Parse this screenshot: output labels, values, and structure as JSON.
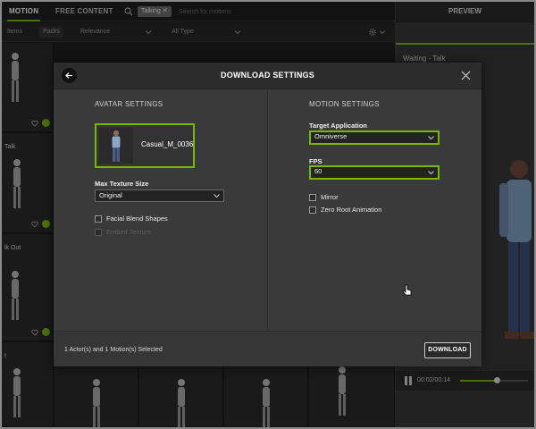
{
  "topbar": {
    "tabs": [
      {
        "label": "MOTION",
        "active": true
      },
      {
        "label": "FREE CONTENT",
        "active": false
      }
    ],
    "search": {
      "icon": "search-icon",
      "chip": "Talking",
      "chip_remove": "✕",
      "placeholder": "Search for motions"
    },
    "preview_header": "PREVIEW"
  },
  "filterbar": {
    "items_label": "Items",
    "packs_label": "Packs",
    "sort_label": "Relevance",
    "type_label": "All Type"
  },
  "grid": {
    "labels": [
      "Talk",
      "lk Out",
      "t"
    ]
  },
  "preview": {
    "title": "Waiting - Talk",
    "time": "00:02/00:14",
    "progress": 0.55
  },
  "modal": {
    "title": "DOWNLOAD SETTINGS",
    "avatar_settings": {
      "title": "AVATAR SETTINGS",
      "avatar_name": "Casual_M_0036",
      "max_texture_label": "Max Texture Size",
      "max_texture_value": "Original",
      "facial_blend_label": "Facial Blend Shapes",
      "embed_texture_label": "Embed Texture"
    },
    "motion_settings": {
      "title": "MOTION SETTINGS",
      "target_app_label": "Target Application",
      "target_app_value": "Omniverse",
      "fps_label": "FPS",
      "fps_value": "60",
      "mirror_label": "Mirror",
      "zero_root_label": "Zero Root Animation"
    },
    "footer": {
      "status": "1 Actor(s) and 1 Motion(s) Selected",
      "download_label": "DOWNLOAD"
    }
  },
  "colors": {
    "accent": "#76b900",
    "modal_bg": "#3a3a3a",
    "header_bg": "#2c2c2c"
  }
}
